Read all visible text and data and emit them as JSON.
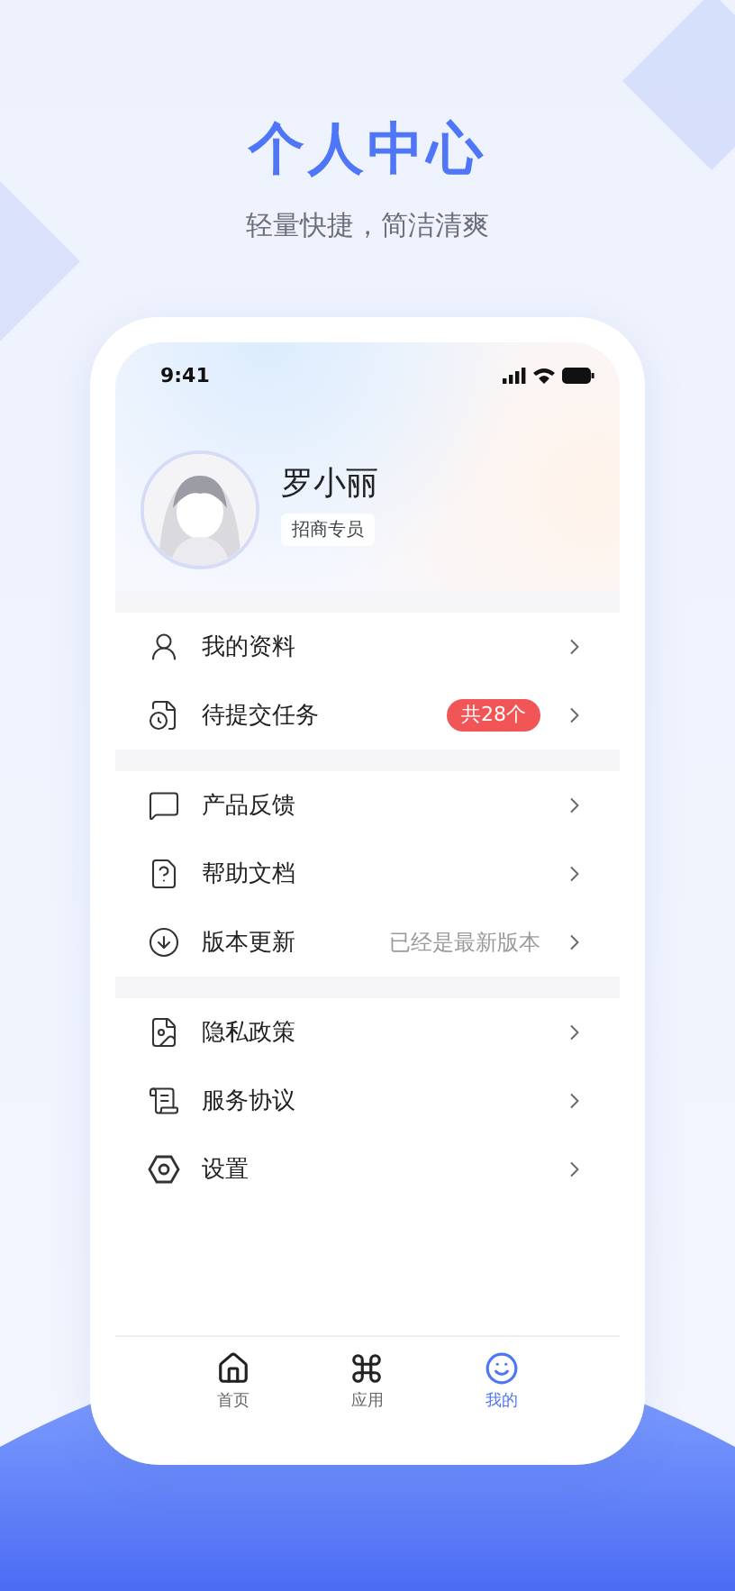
{
  "title": "个人中心",
  "subtitle": "轻量快捷，简洁清爽",
  "status_bar": {
    "time": "9:41"
  },
  "profile": {
    "name": "罗小丽",
    "role": "招商专员"
  },
  "menu_groups": [
    {
      "items": [
        {
          "label": "我的资料",
          "kind": "plain"
        },
        {
          "label": "待提交任务",
          "kind": "badge",
          "badge": "共28个"
        }
      ]
    },
    {
      "items": [
        {
          "label": "产品反馈",
          "kind": "plain"
        },
        {
          "label": "帮助文档",
          "kind": "plain"
        },
        {
          "label": "版本更新",
          "kind": "value",
          "value": "已经是最新版本"
        }
      ]
    },
    {
      "items": [
        {
          "label": "隐私政策",
          "kind": "plain"
        },
        {
          "label": "服务协议",
          "kind": "plain"
        },
        {
          "label": "设置",
          "kind": "plain"
        }
      ]
    }
  ],
  "tabs": [
    {
      "label": "首页",
      "selected": false
    },
    {
      "label": "应用",
      "selected": false
    },
    {
      "label": "我的",
      "selected": true
    }
  ]
}
